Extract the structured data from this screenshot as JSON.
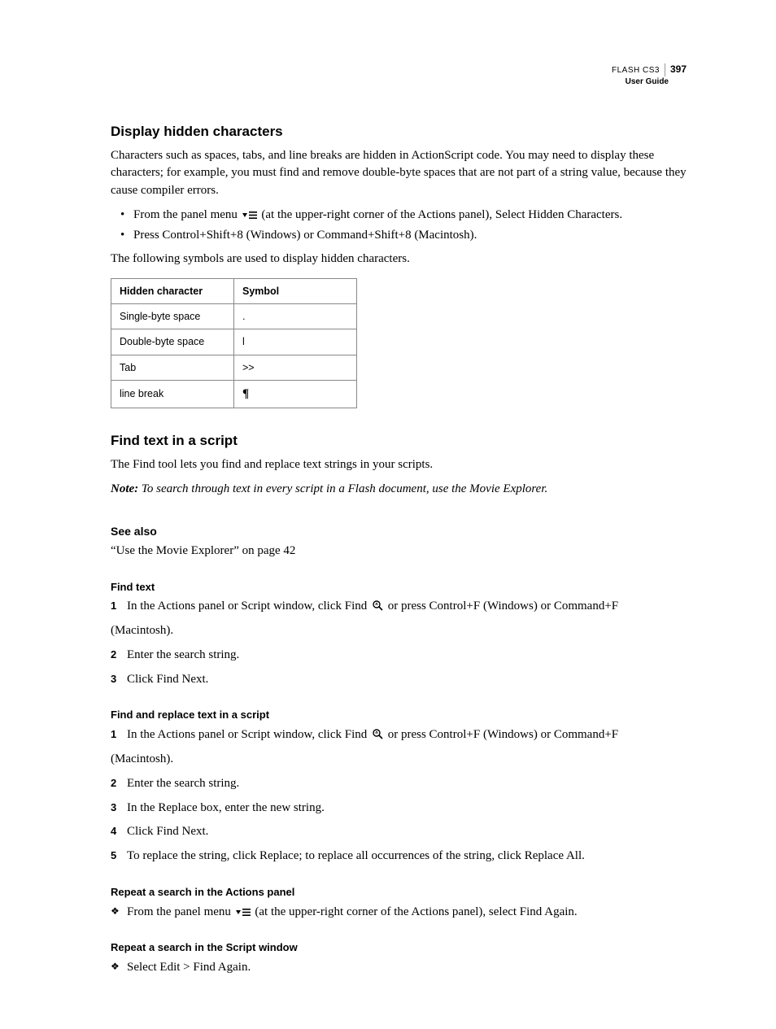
{
  "header": {
    "product": "FLASH CS3",
    "page_number": "397",
    "subtitle": "User Guide"
  },
  "section1": {
    "title": "Display hidden characters",
    "para1": "Characters such as spaces, tabs, and line breaks are hidden in ActionScript code. You may need to display these characters; for example, you must find and remove double-byte spaces that are not part of a string value, because they cause compiler errors.",
    "bullet1a": "From the panel menu ",
    "bullet1b": " (at the upper-right corner of the Actions panel), Select Hidden Characters.",
    "bullet2": "Press Control+Shift+8 (Windows) or Command+Shift+8 (Macintosh).",
    "para2": "The following symbols are used to display hidden characters.",
    "table": {
      "headers": [
        "Hidden character",
        "Symbol"
      ],
      "rows": [
        {
          "c1": "Single-byte space",
          "c2": "."
        },
        {
          "c1": "Double-byte space",
          "c2": "l"
        },
        {
          "c1": "Tab",
          "c2": ">>"
        },
        {
          "c1": "line break",
          "c2": "¶"
        }
      ]
    }
  },
  "section2": {
    "title": "Find text in a script",
    "para1": "The Find tool lets you find and replace text strings in your scripts.",
    "note_label": "Note:",
    "note_text": " To search through text in every script in a Flash document, use the Movie Explorer.",
    "see_also_title": "See also",
    "see_also_text": "“Use the Movie Explorer” on page 42",
    "findtext": {
      "title": "Find text",
      "step1a": "In the Actions panel or Script window, click Find ",
      "step1b": " or press Control+F (Windows) or Command+F",
      "step1cont": "(Macintosh).",
      "step2": "Enter the search string.",
      "step3": "Click Find Next."
    },
    "findreplace": {
      "title": "Find and replace text in a script",
      "step1a": "In the Actions panel or Script window, click Find ",
      "step1b": " or press Control+F (Windows) or Command+F",
      "step1cont": "(Macintosh).",
      "step2": "Enter the search string.",
      "step3": "In the Replace box, enter the new string.",
      "step4": "Click Find Next.",
      "step5": "To replace the string, click Replace; to replace all occurrences of the string, click Replace All."
    },
    "repeat_actions": {
      "title": "Repeat a search in the Actions panel",
      "item_a": "From the panel menu ",
      "item_b": " (at the upper-right corner of the Actions panel), select Find Again."
    },
    "repeat_script": {
      "title": "Repeat a search in the Script window",
      "item": "Select Edit > Find Again."
    }
  }
}
